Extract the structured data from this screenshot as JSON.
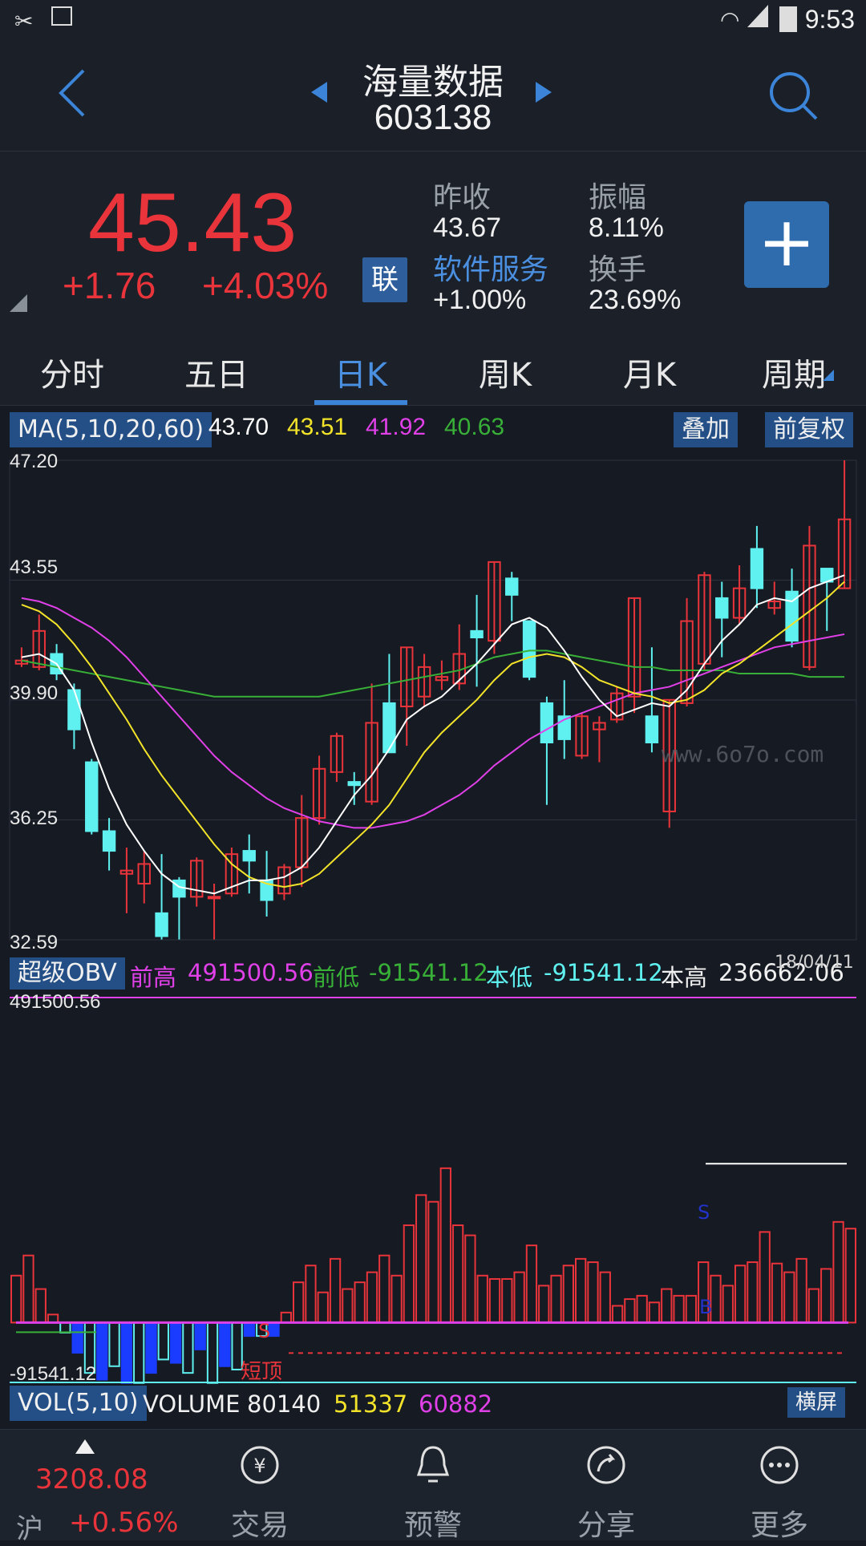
{
  "status": {
    "time": "9:53"
  },
  "header": {
    "title": "海量数据",
    "code": "603138"
  },
  "quote": {
    "price": "45.43",
    "change": "+1.76",
    "change_pct": "+4.03%",
    "lian_label": "联",
    "prev_close_label": "昨收",
    "prev_close": "43.67",
    "amplitude_label": "振幅",
    "amplitude": "8.11%",
    "sector_label": "软件服务",
    "sector_change": "+1.00%",
    "turnover_label": "换手",
    "turnover": "23.69%",
    "add_label": "+"
  },
  "tabs": [
    {
      "label": "分时"
    },
    {
      "label": "五日"
    },
    {
      "label": "日K"
    },
    {
      "label": "周K"
    },
    {
      "label": "月K"
    },
    {
      "label": "周期"
    }
  ],
  "ma": {
    "label": "MA(5,10,20,60)",
    "v5": "43.70",
    "v10": "43.51",
    "v20": "41.92",
    "v60": "40.63",
    "overlay_label": "叠加",
    "adjust_label": "前复权"
  },
  "price_axis": [
    "47.20",
    "43.55",
    "39.90",
    "36.25",
    "32.59"
  ],
  "watermark": "www.6o7o.com",
  "obv": {
    "label": "超级OBV",
    "prev_high_label": "前高",
    "prev_high": "491500.56",
    "prev_low_label": "前低",
    "prev_low": "-91541.12",
    "cur_low_label": "本低",
    "cur_low": "-91541.12",
    "cur_high_label": "本高",
    "cur_high": "236662.06",
    "date": "18/04/11",
    "axis_top": "491500.56",
    "axis_bottom": "-91541.12",
    "marker_s": "S",
    "marker_b": "B",
    "short_label": "短顶"
  },
  "vol": {
    "label": "VOL(5,10)",
    "volume_label": "VOLUME",
    "volume": "80140",
    "ma5": "51337",
    "ma10": "60882",
    "landscape_label": "横屏"
  },
  "index": {
    "value": "3208.08",
    "market": "沪",
    "change": "+0.56%"
  },
  "nav": [
    {
      "label": "交易"
    },
    {
      "label": "预警"
    },
    {
      "label": "分享"
    },
    {
      "label": "更多"
    }
  ],
  "colors": {
    "up": "#e8343a",
    "down": "#5ff0f0",
    "ma5": "#ffffff",
    "ma10": "#f2e32a",
    "ma20": "#e040e8",
    "ma60": "#38b038",
    "accent": "#3b84d8"
  },
  "chart_data": [
    {
      "type": "candlestick",
      "ylim": [
        32.59,
        47.2
      ],
      "tick_labels": [
        "47.20",
        "43.55",
        "39.90",
        "36.25",
        "32.59"
      ],
      "candles": [
        {
          "o": 41.0,
          "c": 41.1,
          "h": 41.5,
          "l": 40.9
        },
        {
          "o": 40.9,
          "c": 42.0,
          "h": 42.5,
          "l": 40.8
        },
        {
          "o": 41.3,
          "c": 40.7,
          "h": 41.6,
          "l": 40.5
        },
        {
          "o": 40.2,
          "c": 39.0,
          "h": 40.4,
          "l": 38.4
        },
        {
          "o": 38.0,
          "c": 35.9,
          "h": 38.1,
          "l": 35.8
        },
        {
          "o": 35.9,
          "c": 35.3,
          "h": 36.3,
          "l": 34.7
        },
        {
          "o": 34.6,
          "c": 34.7,
          "h": 35.4,
          "l": 33.4
        },
        {
          "o": 34.3,
          "c": 34.9,
          "h": 35.3,
          "l": 33.7
        },
        {
          "o": 33.4,
          "c": 32.7,
          "h": 35.2,
          "l": 32.6
        },
        {
          "o": 34.4,
          "c": 33.9,
          "h": 34.5,
          "l": 32.6
        },
        {
          "o": 33.9,
          "c": 35.0,
          "h": 35.1,
          "l": 33.6
        },
        {
          "o": 33.9,
          "c": 33.9,
          "h": 34.3,
          "l": 32.6
        },
        {
          "o": 34.0,
          "c": 35.2,
          "h": 35.4,
          "l": 33.9
        },
        {
          "o": 35.3,
          "c": 35.0,
          "h": 35.8,
          "l": 34.0
        },
        {
          "o": 34.4,
          "c": 33.8,
          "h": 35.3,
          "l": 33.3
        },
        {
          "o": 34.0,
          "c": 34.8,
          "h": 34.9,
          "l": 33.8
        },
        {
          "o": 34.8,
          "c": 36.3,
          "h": 37.0,
          "l": 34.2
        },
        {
          "o": 36.3,
          "c": 37.8,
          "h": 38.2,
          "l": 36.1
        },
        {
          "o": 37.7,
          "c": 38.8,
          "h": 38.9,
          "l": 37.4
        },
        {
          "o": 37.4,
          "c": 37.3,
          "h": 37.7,
          "l": 36.7
        },
        {
          "o": 36.8,
          "c": 39.2,
          "h": 40.4,
          "l": 36.7
        },
        {
          "o": 39.8,
          "c": 38.3,
          "h": 41.3,
          "l": 38.3
        },
        {
          "o": 39.7,
          "c": 41.5,
          "h": 41.5,
          "l": 38.5
        },
        {
          "o": 40.0,
          "c": 40.9,
          "h": 41.3,
          "l": 39.7
        },
        {
          "o": 40.5,
          "c": 40.6,
          "h": 41.1,
          "l": 40.2
        },
        {
          "o": 40.4,
          "c": 41.3,
          "h": 42.2,
          "l": 40.2
        },
        {
          "o": 42.0,
          "c": 41.8,
          "h": 43.1,
          "l": 40.3
        },
        {
          "o": 41.7,
          "c": 44.1,
          "h": 44.1,
          "l": 41.3
        },
        {
          "o": 43.6,
          "c": 43.1,
          "h": 43.8,
          "l": 42.3
        },
        {
          "o": 42.3,
          "c": 40.6,
          "h": 42.3,
          "l": 40.5
        },
        {
          "o": 39.8,
          "c": 38.6,
          "h": 40.0,
          "l": 36.7
        },
        {
          "o": 39.4,
          "c": 38.7,
          "h": 40.5,
          "l": 38.1
        },
        {
          "o": 38.2,
          "c": 39.4,
          "h": 39.5,
          "l": 38.1
        },
        {
          "o": 39.0,
          "c": 39.2,
          "h": 39.4,
          "l": 38.0
        },
        {
          "o": 39.3,
          "c": 40.1,
          "h": 40.3,
          "l": 39.2
        },
        {
          "o": 40.0,
          "c": 43.0,
          "h": 43.0,
          "l": 39.5
        },
        {
          "o": 39.4,
          "c": 38.6,
          "h": 41.5,
          "l": 38.3
        },
        {
          "o": 36.5,
          "c": 39.9,
          "h": 39.9,
          "l": 36.0
        },
        {
          "o": 39.8,
          "c": 42.3,
          "h": 43.0,
          "l": 39.7
        },
        {
          "o": 41.0,
          "c": 43.7,
          "h": 43.8,
          "l": 40.8
        },
        {
          "o": 43.0,
          "c": 42.4,
          "h": 43.5,
          "l": 41.2
        },
        {
          "o": 42.4,
          "c": 43.3,
          "h": 44.0,
          "l": 42.2
        },
        {
          "o": 44.5,
          "c": 43.3,
          "h": 45.2,
          "l": 42.7
        },
        {
          "o": 42.7,
          "c": 42.9,
          "h": 43.5,
          "l": 42.5
        },
        {
          "o": 43.2,
          "c": 41.7,
          "h": 43.9,
          "l": 41.5
        },
        {
          "o": 40.9,
          "c": 44.6,
          "h": 45.2,
          "l": 40.8
        },
        {
          "o": 43.9,
          "c": 43.5,
          "h": 43.9,
          "l": 42.0
        },
        {
          "o": 43.3,
          "c": 45.4,
          "h": 47.2,
          "l": 43.3
        }
      ],
      "ma5": [
        41.2,
        41.3,
        41.0,
        40.2,
        38.6,
        37.2,
        36.1,
        35.3,
        34.6,
        34.2,
        34.1,
        34.0,
        34.2,
        34.4,
        34.4,
        34.5,
        34.8,
        35.4,
        36.2,
        37.0,
        37.6,
        38.4,
        39.3,
        39.7,
        40.0,
        40.5,
        41.0,
        41.6,
        42.2,
        42.4,
        42.1,
        41.4,
        40.6,
        39.9,
        39.4,
        39.6,
        39.8,
        39.7,
        40.2,
        41.0,
        41.7,
        42.2,
        42.8,
        43.0,
        42.9,
        43.3,
        43.5,
        43.7
      ],
      "ma10": [
        42.8,
        42.6,
        42.2,
        41.6,
        40.9,
        40.1,
        39.3,
        38.4,
        37.6,
        36.9,
        36.2,
        35.5,
        34.9,
        34.5,
        34.3,
        34.2,
        34.3,
        34.6,
        35.1,
        35.6,
        36.1,
        36.7,
        37.5,
        38.3,
        38.9,
        39.4,
        39.9,
        40.5,
        41.0,
        41.2,
        41.3,
        41.2,
        40.9,
        40.5,
        40.3,
        40.1,
        40.0,
        39.8,
        39.9,
        40.2,
        40.7,
        41.0,
        41.4,
        41.8,
        42.2,
        42.6,
        43.0,
        43.5
      ],
      "ma20": [
        43.0,
        42.9,
        42.7,
        42.4,
        42.1,
        41.7,
        41.2,
        40.6,
        40.0,
        39.4,
        38.8,
        38.2,
        37.7,
        37.3,
        36.9,
        36.6,
        36.4,
        36.2,
        36.1,
        36.0,
        36.0,
        36.1,
        36.2,
        36.4,
        36.7,
        37.0,
        37.4,
        37.9,
        38.3,
        38.7,
        39.0,
        39.3,
        39.5,
        39.7,
        39.9,
        40.1,
        40.2,
        40.3,
        40.5,
        40.7,
        40.9,
        41.1,
        41.3,
        41.5,
        41.6,
        41.7,
        41.8,
        41.9
      ],
      "ma60": [
        41.1,
        41.0,
        40.9,
        40.8,
        40.7,
        40.6,
        40.5,
        40.4,
        40.3,
        40.2,
        40.1,
        40.0,
        40.0,
        40.0,
        40.0,
        40.0,
        40.0,
        40.0,
        40.1,
        40.2,
        40.3,
        40.4,
        40.5,
        40.6,
        40.7,
        40.8,
        41.0,
        41.2,
        41.3,
        41.4,
        41.4,
        41.3,
        41.2,
        41.1,
        41.0,
        40.9,
        40.9,
        40.8,
        40.8,
        40.8,
        40.8,
        40.7,
        40.7,
        40.7,
        40.7,
        40.6,
        40.6,
        40.6
      ]
    },
    {
      "type": "bar",
      "title": "超级OBV",
      "ylim": [
        -91541.12,
        491500.56
      ],
      "values": [
        70000,
        100000,
        50000,
        12000,
        -15000,
        -45000,
        -75000,
        -85000,
        -65000,
        -90000,
        -90000,
        -75000,
        -55000,
        -60000,
        -75000,
        -40000,
        -90000,
        -65000,
        -70000,
        -20000,
        -20000,
        -20000,
        15000,
        60000,
        85000,
        45000,
        95000,
        50000,
        60000,
        75000,
        100000,
        70000,
        145000,
        190000,
        180000,
        230000,
        145000,
        130000,
        70000,
        65000,
        65000,
        75000,
        115000,
        55000,
        70000,
        85000,
        95000,
        90000,
        75000,
        25000,
        35000,
        40000,
        30000,
        50000,
        40000,
        40000,
        90000,
        70000,
        55000,
        85000,
        90000,
        135000,
        88000,
        75000,
        95000,
        50000,
        80000,
        150000,
        140000
      ],
      "reference_high": 236662.06
    }
  ]
}
